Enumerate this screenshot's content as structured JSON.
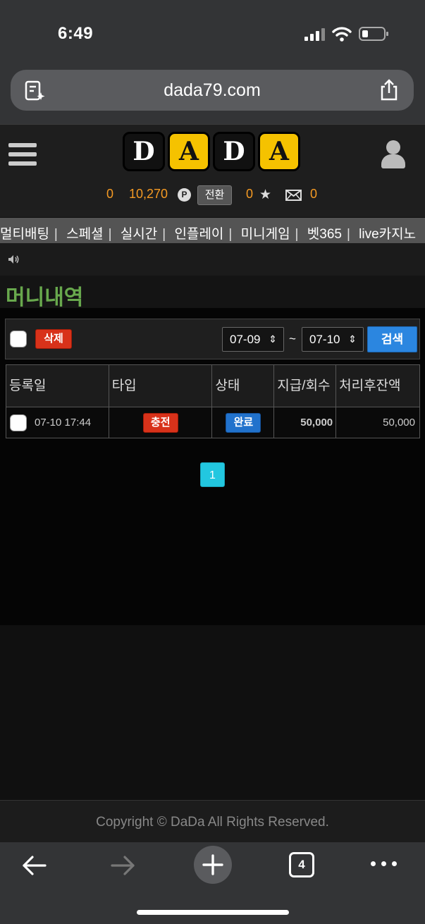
{
  "status": {
    "time": "6:49"
  },
  "browser": {
    "url": "dada79.com",
    "tab_count": "4"
  },
  "header": {
    "logo_letters": [
      "D",
      "A",
      "D",
      "A"
    ],
    "money": "0",
    "points": "10,270",
    "point_badge": "P",
    "convert_label": "전환",
    "stars": "0",
    "messages": "0"
  },
  "nav": {
    "items": [
      "멀티배팅",
      "스페셜",
      "실시간",
      "인플레이",
      "미니게임",
      "벳365",
      "live카지노"
    ]
  },
  "page": {
    "title": "머니내역"
  },
  "toolbar": {
    "delete_label": "삭제",
    "date_from": "07-09",
    "date_to": "07-10",
    "tilde": "~",
    "search_label": "검색"
  },
  "table": {
    "headers": [
      "등록일",
      "타입",
      "상태",
      "지급/회수",
      "처리후잔액"
    ],
    "rows": [
      {
        "date": "07-10 17:44",
        "type": "충전",
        "status": "완료",
        "amount": "50,000",
        "balance": "50,000"
      }
    ]
  },
  "pagination": {
    "current": "1"
  },
  "footer": {
    "copyright": "Copyright © DaDa All Rights Reserved."
  },
  "colors": {
    "accent_orange": "#f59a23",
    "title_green": "#68a84d",
    "red": "#d8321a",
    "blue": "#2172cc",
    "page_cyan": "#22c7e0"
  }
}
